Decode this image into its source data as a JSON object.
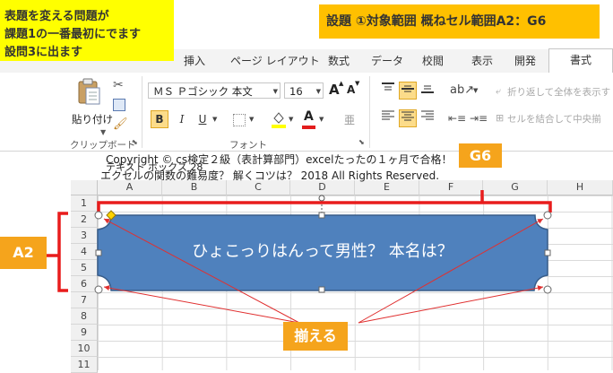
{
  "ribbon": {
    "tabs": [
      {
        "label": "挿入"
      },
      {
        "label": "ページ レイアウト"
      },
      {
        "label": "数式"
      },
      {
        "label": "データ"
      },
      {
        "label": "校閲"
      },
      {
        "label": "表示"
      },
      {
        "label": "開発"
      }
    ],
    "active_tab": "書式",
    "clipboard": {
      "paste_label": "貼り付け",
      "group_label": "クリップボード"
    },
    "font": {
      "name": "ＭＳ Ｐゴシック 本文",
      "size": "16",
      "grow": "A",
      "shrink": "A",
      "bold": "B",
      "italic": "I",
      "underline": "U",
      "font_color_glyph": "A",
      "group_label": "フォント"
    },
    "alignment": {
      "wrap_text": "折り返して全体を表示す",
      "merge_center": "セルを結合して中央揃"
    }
  },
  "sheet": {
    "columns": [
      "A",
      "B",
      "C",
      "D",
      "E",
      "F",
      "G",
      "H"
    ],
    "rows": [
      "1",
      "2",
      "3",
      "4",
      "5",
      "6",
      "7",
      "8",
      "9",
      "10",
      "11"
    ],
    "namebox_overlap": "テキスト ボックス 28",
    "shape_text": "ひょこっりはんって男性？ 本名は？"
  },
  "watermark": {
    "line1": "Copyright © cs検定２級（表計算部門）excelたったの１ヶ月で合格！",
    "line2": "エクセルの関数の難易度？ 解くコツは？ 2018 All Rights Reserved."
  },
  "annotations": {
    "yellow_note": [
      "表題を変える問題が",
      "課題1の一番最初にでます",
      "設問3に出ます"
    ],
    "title_note": "設題 ①対象範囲 概ねセル範囲A2：G6",
    "g6_label": "G6",
    "a2_label": "A2",
    "align_label": "揃える"
  },
  "colors": {
    "shape_fill": "#4f81bd",
    "orange_label": "#f5a41c",
    "yellow_note_bg": "#ffff00",
    "red_bracket": "#e81c1c"
  }
}
